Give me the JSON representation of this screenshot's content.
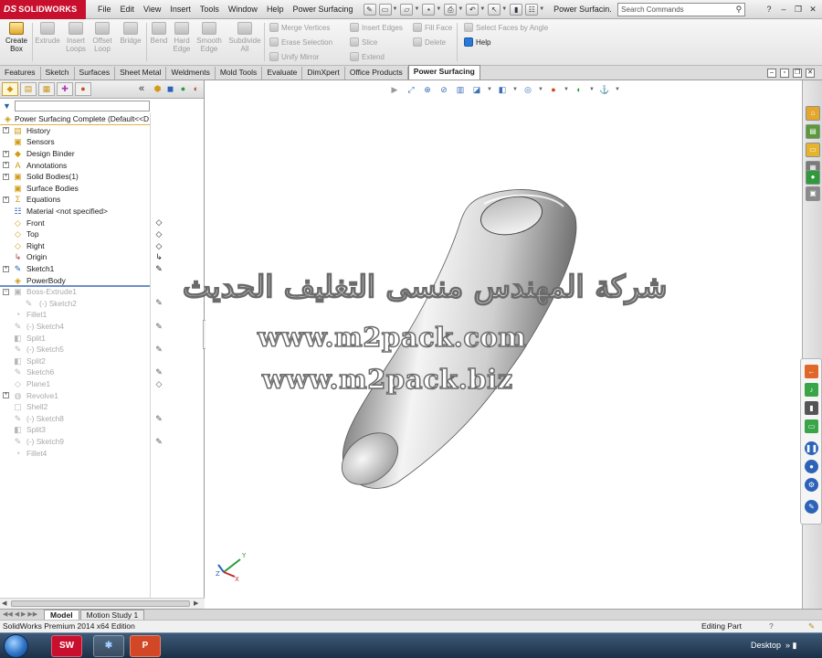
{
  "app": {
    "logo_text": "SOLIDWORKS",
    "logo_mark": "DS"
  },
  "menu": [
    "File",
    "Edit",
    "View",
    "Insert",
    "Tools",
    "Window",
    "Help",
    "Power Surfacing"
  ],
  "titlebar": {
    "doc_title": "Power Surfacin...",
    "search_placeholder": "Search Commands"
  },
  "command_manager": {
    "large": [
      {
        "label": "Create\nBox",
        "active": true
      },
      {
        "label": "Extrude",
        "active": false
      },
      {
        "label": "Insert\nLoops",
        "active": false
      },
      {
        "label": "Offset\nLoop",
        "active": false
      },
      {
        "label": "Bridge",
        "active": false
      },
      {
        "label": "Bend",
        "active": false
      },
      {
        "label": "Hard\nEdge",
        "active": false
      },
      {
        "label": "Smooth\nEdge",
        "active": false
      },
      {
        "label": "Subdivide\nAll",
        "active": false
      }
    ],
    "small": [
      {
        "label": "Merge Vertices",
        "active": false
      },
      {
        "label": "Erase Selection",
        "active": false
      },
      {
        "label": "Unify Mirror",
        "active": false
      },
      {
        "label": "Insert Edges",
        "active": false
      },
      {
        "label": "Slice",
        "active": false
      },
      {
        "label": "Extend",
        "active": false
      },
      {
        "label": "Fill Face",
        "active": false
      },
      {
        "label": "Delete",
        "active": false
      },
      {
        "label": "Select Faces by Angle",
        "active": false
      },
      {
        "label": "Help",
        "active": true
      }
    ]
  },
  "tabs": [
    "Features",
    "Sketch",
    "Surfaces",
    "Sheet Metal",
    "Weldments",
    "Mold Tools",
    "Evaluate",
    "DimXpert",
    "Office Products",
    "Power Surfacing"
  ],
  "tree": {
    "root": "Power Surfacing Complete  (Default<<D",
    "items": [
      {
        "label": "History",
        "icon": "history-icon"
      },
      {
        "label": "Sensors",
        "icon": "sensors-icon"
      },
      {
        "label": "Design Binder",
        "icon": "design-binder-icon"
      },
      {
        "label": "Annotations",
        "icon": "annotations-icon"
      },
      {
        "label": "Solid Bodies(1)",
        "icon": "solid-bodies-icon"
      },
      {
        "label": "Surface Bodies",
        "icon": "surface-bodies-icon"
      },
      {
        "label": "Equations",
        "icon": "equations-icon"
      },
      {
        "label": "Material <not specified>",
        "icon": "material-icon"
      },
      {
        "label": "Front",
        "icon": "plane-icon"
      },
      {
        "label": "Top",
        "icon": "plane-icon"
      },
      {
        "label": "Right",
        "icon": "plane-icon"
      },
      {
        "label": "Origin",
        "icon": "origin-icon"
      },
      {
        "label": "Sketch1",
        "icon": "sketch-icon"
      },
      {
        "label": "PowerBody",
        "icon": "power-body-icon"
      },
      {
        "label": "Boss-Extrude1",
        "icon": "extrude-icon"
      },
      {
        "label": "(-) Sketch2",
        "icon": "sketch-icon"
      },
      {
        "label": "Fillet1",
        "icon": "fillet-icon"
      },
      {
        "label": "(-) Sketch4",
        "icon": "sketch-icon"
      },
      {
        "label": "Split1",
        "icon": "split-icon"
      },
      {
        "label": "(-) Sketch5",
        "icon": "sketch-icon"
      },
      {
        "label": "Split2",
        "icon": "split-icon"
      },
      {
        "label": "Sketch6",
        "icon": "sketch-icon"
      },
      {
        "label": "Plane1",
        "icon": "plane-icon"
      },
      {
        "label": "Revolve1",
        "icon": "revolve-icon"
      },
      {
        "label": "Shell2",
        "icon": "shell-icon"
      },
      {
        "label": "(-) Sketch8",
        "icon": "sketch-icon"
      },
      {
        "label": "Split3",
        "icon": "split-icon"
      },
      {
        "label": "(-) Sketch9",
        "icon": "sketch-icon"
      },
      {
        "label": "Fillet4",
        "icon": "fillet-icon"
      }
    ]
  },
  "watermark": {
    "arabic": "شركة المهندس منسى التغليف الحديث",
    "url1": "www.m2pack.com",
    "url2": "www.m2pack.biz"
  },
  "bottom_tabs": [
    "Model",
    "Motion Study 1"
  ],
  "status": {
    "left": "SolidWorks Premium 2014 x64 Edition",
    "right": "Editing Part"
  },
  "taskbar": {
    "desktop_label": "Desktop"
  },
  "colors": {
    "brand": "#c8102e",
    "accent": "#e8a319",
    "taskbar": "#22384f"
  }
}
